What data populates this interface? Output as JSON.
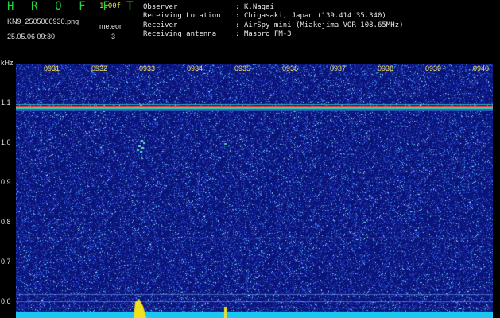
{
  "app": {
    "title": "H R O F F T",
    "version": "1.00f",
    "filename": "KN9_2505060930.png",
    "datetime": "25.05.06 09:30",
    "meteor_label": "meteor",
    "meteor_count": "3"
  },
  "info": [
    {
      "key": "Observer",
      "value": "K.Nagai"
    },
    {
      "key": "Receiving Location",
      "value": "Chigasaki, Japan (139.414 35.340)"
    },
    {
      "key": "Receiver",
      "value": "AirSpy mini (Miakejima VOR 108.65MHz)"
    },
    {
      "key": "Receiving antenna",
      "value": "Maspro FM-3"
    }
  ],
  "colon": ":",
  "axes": {
    "y_unit": "kHz",
    "y_ticks": [
      "1.1",
      "1.0",
      "0.9",
      "0.8",
      "0.7",
      "0.6"
    ],
    "x_ticks": [
      "0931",
      "0932",
      "0933",
      "0934",
      "0935",
      "0936",
      "0937",
      "0938",
      "0939",
      "0940"
    ]
  },
  "colors": {
    "background": "#000000",
    "spectrogram_bg": "#0b1a8c",
    "carrier": "#ff3030",
    "baseline": "#19c8f0",
    "peak": "#f0e020"
  }
}
